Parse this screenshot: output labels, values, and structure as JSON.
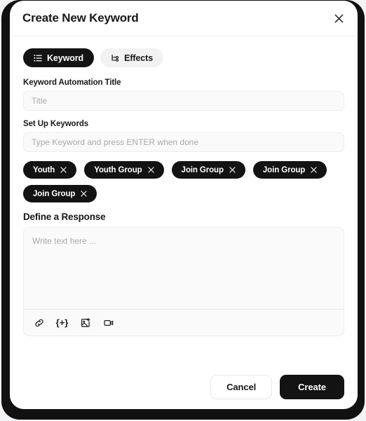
{
  "window": {
    "backdrop_color": "#111111",
    "card_background": "#ffffff"
  },
  "header": {
    "title": "Create New Keyword",
    "close_icon": "close-icon"
  },
  "tabs": [
    {
      "label": "Keyword",
      "icon": "list-icon",
      "active": true
    },
    {
      "label": "Effects",
      "icon": "branch-icon",
      "active": false
    }
  ],
  "fields": {
    "automation_title": {
      "label": "Keyword Automation Title",
      "placeholder": "Title",
      "value": ""
    },
    "setup_keywords": {
      "label": "Set Up Keywords",
      "placeholder": "Type Keyword and press ENTER when done",
      "value": ""
    }
  },
  "keyword_chips": [
    {
      "label": "Youth",
      "remove_icon": "close-icon"
    },
    {
      "label": "Youth Group",
      "remove_icon": "close-icon"
    },
    {
      "label": "Join Group",
      "remove_icon": "close-icon"
    },
    {
      "label": "Join Group",
      "remove_icon": "close-icon"
    },
    {
      "label": "Join Group",
      "remove_icon": "close-icon"
    }
  ],
  "response": {
    "heading": "Define a Response",
    "placeholder": "Write text here ...",
    "value": "",
    "toolbar": [
      {
        "icon": "link-icon",
        "glyph": ""
      },
      {
        "icon": "variable-icon",
        "glyph": "{+}"
      },
      {
        "icon": "image-add-icon",
        "glyph": ""
      },
      {
        "icon": "video-icon",
        "glyph": ""
      }
    ]
  },
  "footer": {
    "cancel_label": "Cancel",
    "create_label": "Create"
  },
  "colors": {
    "accent": "#131313",
    "field_bg": "#fafafa",
    "border": "#ededed",
    "placeholder": "#a9a9a9"
  }
}
